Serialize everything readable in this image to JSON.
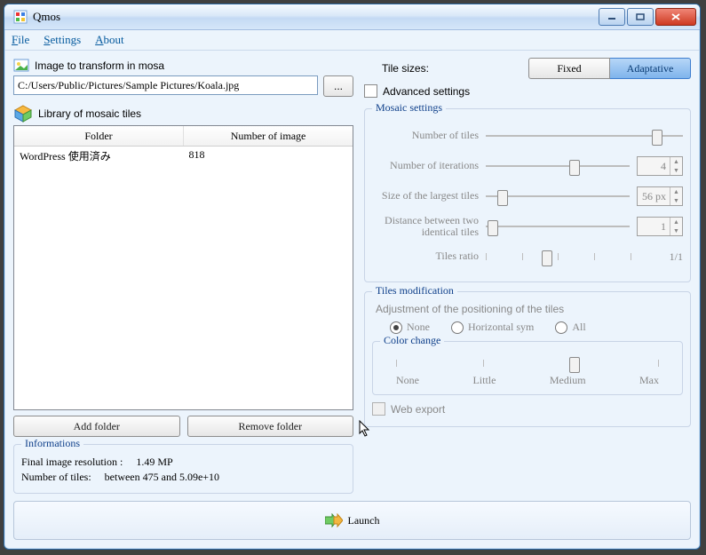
{
  "window": {
    "title": "Qmos"
  },
  "menubar": {
    "file": "File",
    "settings": "Settings",
    "about": "About"
  },
  "left": {
    "imageToTransformLabel": "Image to transform in mosa",
    "imagePath": "C:/Users/Public/Pictures/Sample Pictures/Koala.jpg",
    "browseLabel": "...",
    "libraryLabel": "Library of mosaic tiles",
    "table": {
      "headers": {
        "folder": "Folder",
        "count": "Number of image"
      },
      "rows": [
        {
          "folder": "WordPress 使用済み",
          "count": "818"
        }
      ]
    },
    "addFolder": "Add folder",
    "removeFolder": "Remove folder",
    "info": {
      "legend": "Informations",
      "resolutionLabel": "Final image resolution :",
      "resolutionValue": "1.49 MP",
      "tilesLabel": "Number of tiles:",
      "tilesValue": "between 475 and 5.09e+10"
    }
  },
  "right": {
    "tileSizesLabel": "Tile sizes:",
    "fixed": "Fixed",
    "adaptative": "Adaptative",
    "tileSizeMode": "Adaptative",
    "advancedLabel": "Advanced settings",
    "advancedChecked": false,
    "mosaic": {
      "legend": "Mosaic settings",
      "numTiles": {
        "label": "Number of tiles",
        "pos": 0.87
      },
      "numIter": {
        "label": "Number of iterations",
        "pos": 0.62,
        "value": "4"
      },
      "largest": {
        "label": "Size of the largest tiles",
        "pos": 0.12,
        "value": "56 px"
      },
      "distance": {
        "label": "Distance between two identical tiles",
        "pos": 0.05,
        "value": "1"
      },
      "ratio": {
        "label": "Tiles ratio",
        "pos": 0.42,
        "value": "1/1"
      }
    },
    "tilesMod": {
      "legend": "Tiles modification",
      "adjustmentLabel": "Adjustment of the positioning of the tiles",
      "options": {
        "none": "None",
        "hsym": "Horizontal sym",
        "all": "All"
      },
      "selected": "none",
      "colorChange": {
        "legend": "Color change",
        "pos": 0.68,
        "labels": {
          "none": "None",
          "little": "Little",
          "medium": "Medium",
          "max": "Max"
        }
      },
      "webExport": "Web export",
      "webExportChecked": false
    }
  },
  "launch": {
    "label": "Launch"
  }
}
